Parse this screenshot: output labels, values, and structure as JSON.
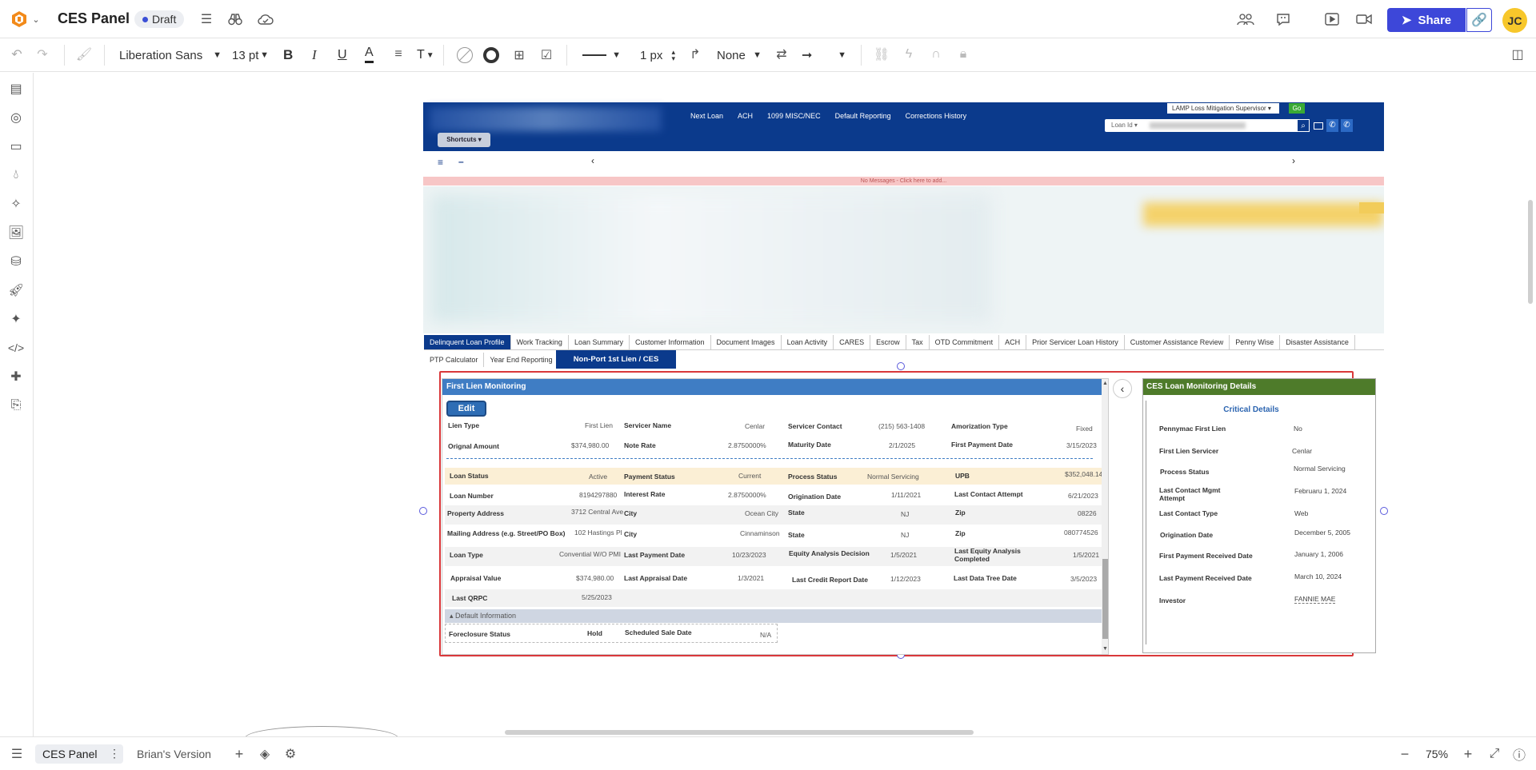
{
  "app": {
    "doc_title": "CES Panel",
    "status_badge": "Draft",
    "share_label": "Share",
    "avatar_initials": "JC",
    "accent": "#3d47d9"
  },
  "toolbar": {
    "font_family": "Liberation Sans",
    "font_size": "13 pt",
    "line_width": "1 px",
    "line_end": "None"
  },
  "bottom": {
    "page_active": "CES Panel",
    "page_other": "Brian's Version",
    "zoom": "75%"
  },
  "mock": {
    "nav_links": [
      "Next Loan",
      "ACH",
      "1099 MISC/NEC",
      "Default Reporting",
      "Corrections History"
    ],
    "role_select": "LAMP Loss Mitigation Supervisor ▾",
    "go_label": "Go",
    "loan_id_select": "Loan Id ▾",
    "shortcuts": "Shortcuts ▾",
    "messages": "No Messages - Click here to add...",
    "tabs_row1": [
      "Delinquent Loan Profile",
      "Work Tracking",
      "Loan Summary",
      "Customer Information",
      "Document Images",
      "Loan Activity",
      "CARES",
      "Escrow",
      "Tax",
      "OTD Commitment",
      "ACH",
      "Prior Servicer Loan History",
      "Customer Assistance Review",
      "Penny Wise",
      "Disaster Assistance"
    ],
    "tabs_row2": [
      "PTP Calculator",
      "Year End Reporting"
    ],
    "tab_active2": "Non-Port 1st Lien / CES",
    "left_panel": {
      "title": "First Lien Monitoring",
      "edit": "Edit",
      "row1": {
        "l1": "Lien Type",
        "v1": "First Lien",
        "l2": "Servicer Name",
        "v2": "Cenlar",
        "l3": "Servicer Contact",
        "v3": "(215) 563-1408",
        "l4": "Amorization Type",
        "v4": "Fixed"
      },
      "row2": {
        "l1": "Orignal Amount",
        "v1": "$374,980.00",
        "l2": "Note Rate",
        "v2": "2.8750000%",
        "l3": "Maturity Date",
        "v3": "2/1/2025",
        "l4": "First Payment Date",
        "v4": "3/15/2023"
      },
      "row3": {
        "l1": "Loan Status",
        "v1": "Active",
        "l2": "Payment Status",
        "v2": "Current",
        "l3": "Process Status",
        "v3": "Normal Servicing",
        "l4": "UPB",
        "v4": "$352,048.14"
      },
      "row4": {
        "l1": "Loan Number",
        "v1": "8194297880",
        "l2": "Interest Rate",
        "v2": "2.8750000%",
        "l3": "Origination Date",
        "v3": "1/11/2021",
        "l4": "Last Contact Attempt",
        "v4": "6/21/2023"
      },
      "row5": {
        "l1": "Property Address",
        "v1": "3712 Central Ave",
        "l2": "City",
        "v2": "Ocean City",
        "l3": "State",
        "v3": "NJ",
        "l4": "Zip",
        "v4": "08226"
      },
      "row6": {
        "l1": "Mailing Address (e.g. Street/PO Box)",
        "v1": "102 Hastings Pl",
        "l2": "City",
        "v2": "Cinnaminson",
        "l3": "State",
        "v3": "NJ",
        "l4": "Zip",
        "v4": "080774526"
      },
      "row7": {
        "l1": "Loan Type",
        "v1": "Convential W/O PMI",
        "l2": "Last Payment Date",
        "v2": "10/23/2023",
        "l3": "Equity Analysis Decision",
        "v3": "1/5/2021",
        "l4": "Last Equity Analysis Completed",
        "v4": "1/5/2021"
      },
      "row8": {
        "l1": "Appraisal Value",
        "v1": "$374,980.00",
        "l2": "Last Appraisal Date",
        "v2": "1/3/2021",
        "l3": "Last Credit Report Date",
        "v3": "1/12/2023",
        "l4": "Last Data Tree Date",
        "v4": "3/5/2023"
      },
      "row9": {
        "l1": "Last QRPC",
        "v1": "5/25/2023"
      },
      "default_info": "▴ Default Information",
      "default_row": {
        "l1": "Foreclosure Status",
        "v1": "Hold",
        "l2": "Scheduled Sale Date",
        "v2": "N/A"
      }
    },
    "right_panel": {
      "title": "CES Loan Monitoring Details",
      "subtitle": "Critical Details",
      "rows": [
        {
          "label": "Pennymac First Lien",
          "value": "No"
        },
        {
          "label": "First Lien Servicer",
          "value": "Cenlar"
        },
        {
          "label": "Process Status",
          "value": "Normal Servicing"
        },
        {
          "label": "Last Contact Mgmt Attempt",
          "value": "Februaru 1, 2024"
        },
        {
          "label": "Last Contact Type",
          "value": "Web"
        },
        {
          "label": "Origination Date",
          "value": "December 5, 2005"
        },
        {
          "label": "First Payment Received Date",
          "value": "January 1, 2006"
        },
        {
          "label": "Last Payment Received Date",
          "value": "March 10, 2024"
        },
        {
          "label": "Investor",
          "value": "FANNIE MAE"
        }
      ]
    }
  }
}
